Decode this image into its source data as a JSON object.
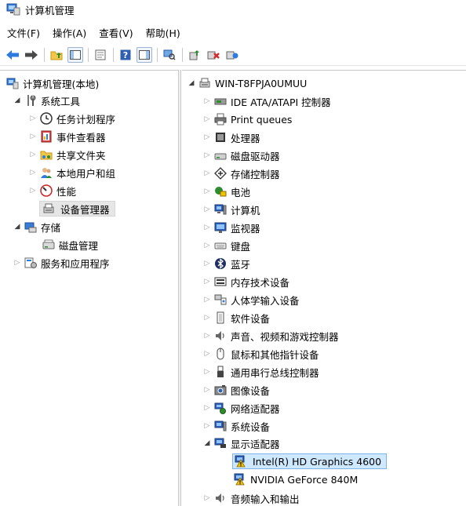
{
  "window": {
    "title": "计算机管理"
  },
  "menu": {
    "file": "文件(F)",
    "action": "操作(A)",
    "view": "查看(V)",
    "help": "帮助(H)"
  },
  "left_tree": {
    "root": "计算机管理(本地)",
    "system_tools": "系统工具",
    "task_scheduler": "任务计划程序",
    "event_viewer": "事件查看器",
    "shared_folders": "共享文件夹",
    "local_users": "本地用户和组",
    "performance": "性能",
    "device_manager": "设备管理器",
    "storage": "存储",
    "disk_management": "磁盘管理",
    "services_apps": "服务和应用程序"
  },
  "device_tree": {
    "computer": "WIN-T8FPJA0UMUU",
    "categories": [
      {
        "label": "IDE ATA/ATAPI 控制器",
        "icon": "ide-controller-icon"
      },
      {
        "label": "Print queues",
        "icon": "printer-icon"
      },
      {
        "label": "处理器",
        "icon": "processor-icon"
      },
      {
        "label": "磁盘驱动器",
        "icon": "disk-drive-icon"
      },
      {
        "label": "存储控制器",
        "icon": "storage-controller-icon"
      },
      {
        "label": "电池",
        "icon": "battery-icon"
      },
      {
        "label": "计算机",
        "icon": "computer-icon"
      },
      {
        "label": "监视器",
        "icon": "monitor-icon"
      },
      {
        "label": "键盘",
        "icon": "keyboard-icon"
      },
      {
        "label": "蓝牙",
        "icon": "bluetooth-icon"
      },
      {
        "label": "内存技术设备",
        "icon": "memory-icon"
      },
      {
        "label": "人体学输入设备",
        "icon": "hid-icon"
      },
      {
        "label": "软件设备",
        "icon": "software-device-icon"
      },
      {
        "label": "声音、视频和游戏控制器",
        "icon": "speaker-icon"
      },
      {
        "label": "鼠标和其他指针设备",
        "icon": "mouse-icon"
      },
      {
        "label": "通用串行总线控制器",
        "icon": "usb-icon"
      },
      {
        "label": "图像设备",
        "icon": "camera-icon"
      },
      {
        "label": "网络适配器",
        "icon": "network-adapter-icon"
      },
      {
        "label": "系统设备",
        "icon": "system-device-icon"
      }
    ],
    "display_adapters": "显示适配器",
    "display_children": [
      "Intel(R) HD Graphics 4600",
      "NVIDIA GeForce 840M"
    ],
    "audio_io": "音频输入和输出"
  }
}
